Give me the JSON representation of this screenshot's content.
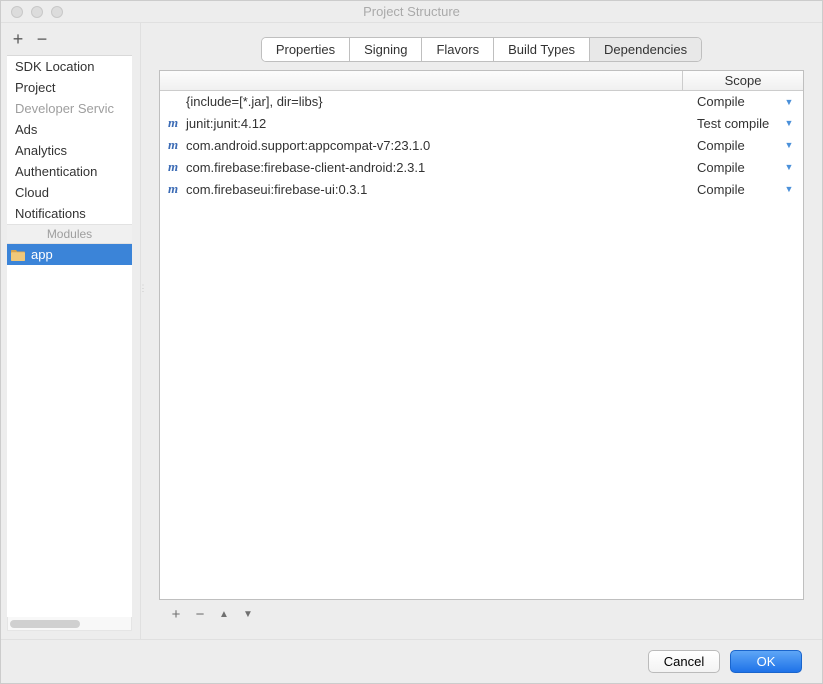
{
  "window": {
    "title": "Project Structure"
  },
  "sidebar": {
    "toolbar": {
      "plus": "+",
      "minus": "−"
    },
    "items": [
      {
        "label": "SDK Location",
        "type": "item"
      },
      {
        "label": "Project",
        "type": "item"
      },
      {
        "label": "Developer Servic",
        "type": "heading"
      },
      {
        "label": "Ads",
        "type": "item"
      },
      {
        "label": "Analytics",
        "type": "item"
      },
      {
        "label": "Authentication",
        "type": "item"
      },
      {
        "label": "Cloud",
        "type": "item"
      },
      {
        "label": "Notifications",
        "type": "item"
      }
    ],
    "modules_label": "Modules",
    "modules": [
      {
        "label": "app",
        "selected": true
      }
    ]
  },
  "tabs": [
    {
      "label": "Properties",
      "active": false
    },
    {
      "label": "Signing",
      "active": false
    },
    {
      "label": "Flavors",
      "active": false
    },
    {
      "label": "Build Types",
      "active": false
    },
    {
      "label": "Dependencies",
      "active": true
    }
  ],
  "deps_table": {
    "scope_header": "Scope",
    "rows": [
      {
        "icon": "",
        "text": "{include=[*.jar], dir=libs}",
        "scope": "Compile"
      },
      {
        "icon": "m",
        "text": "junit:junit:4.12",
        "scope": "Test compile"
      },
      {
        "icon": "m",
        "text": "com.android.support:appcompat-v7:23.1.0",
        "scope": "Compile"
      },
      {
        "icon": "m",
        "text": "com.firebase:firebase-client-android:2.3.1",
        "scope": "Compile"
      },
      {
        "icon": "m",
        "text": "com.firebaseui:firebase-ui:0.3.1",
        "scope": "Compile"
      }
    ],
    "footer": {
      "plus": "+",
      "minus": "−",
      "up": "▲",
      "down": "▼"
    }
  },
  "buttons": {
    "cancel": "Cancel",
    "ok": "OK"
  }
}
